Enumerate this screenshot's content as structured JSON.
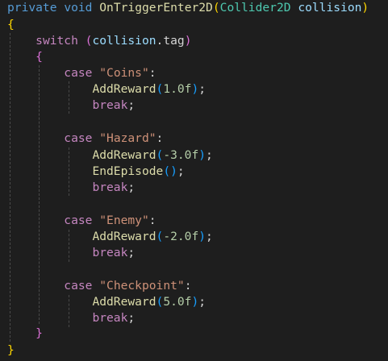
{
  "colors": {
    "background": "#1e1e1e",
    "keyword": "#569cd6",
    "control": "#c586c0",
    "function": "#dcdcaa",
    "type": "#4ec9b0",
    "variable": "#9cdcfe",
    "string": "#ce9178",
    "number": "#b5cea8",
    "bracket_level1": "#ffd700",
    "bracket_level2": "#da70d6",
    "bracket_level3": "#179fff"
  },
  "code": {
    "signature": {
      "modifier": "private",
      "return_type": "void",
      "method_name": "OnTriggerEnter2D",
      "open_paren": "(",
      "param_type": "Collider2D",
      "param_name": "collision",
      "close_paren": ")"
    },
    "method_open_brace": "{",
    "method_close_brace": "}",
    "switch_statement": {
      "keyword": "switch",
      "open_paren": "(",
      "target_object": "collision",
      "member_access": ".tag",
      "close_paren": ")",
      "open_brace": "{",
      "close_brace": "}"
    },
    "cases": [
      {
        "keyword": "case",
        "label": "\"Coins\"",
        "calls": [
          {
            "name": "AddReward",
            "open_paren": "(",
            "arg": "1.0f",
            "close_paren": ")",
            "semicolon": ";"
          }
        ],
        "break_keyword": "break",
        "break_semicolon": ";"
      },
      {
        "keyword": "case",
        "label": "\"Hazard\"",
        "calls": [
          {
            "name": "AddReward",
            "open_paren": "(",
            "arg": "-3.0f",
            "close_paren": ")",
            "semicolon": ";"
          },
          {
            "name": "EndEpisode",
            "open_paren": "(",
            "arg": "",
            "close_paren": ")",
            "semicolon": ";"
          }
        ],
        "break_keyword": "break",
        "break_semicolon": ";"
      },
      {
        "keyword": "case",
        "label": "\"Enemy\"",
        "calls": [
          {
            "name": "AddReward",
            "open_paren": "(",
            "arg": "-2.0f",
            "close_paren": ")",
            "semicolon": ";"
          }
        ],
        "break_keyword": "break",
        "break_semicolon": ";"
      },
      {
        "keyword": "case",
        "label": "\"Checkpoint\"",
        "calls": [
          {
            "name": "AddReward",
            "open_paren": "(",
            "arg": "5.0f",
            "close_paren": ")",
            "semicolon": ";"
          }
        ],
        "break_keyword": "break",
        "break_semicolon": ";"
      }
    ],
    "colon": ":"
  }
}
